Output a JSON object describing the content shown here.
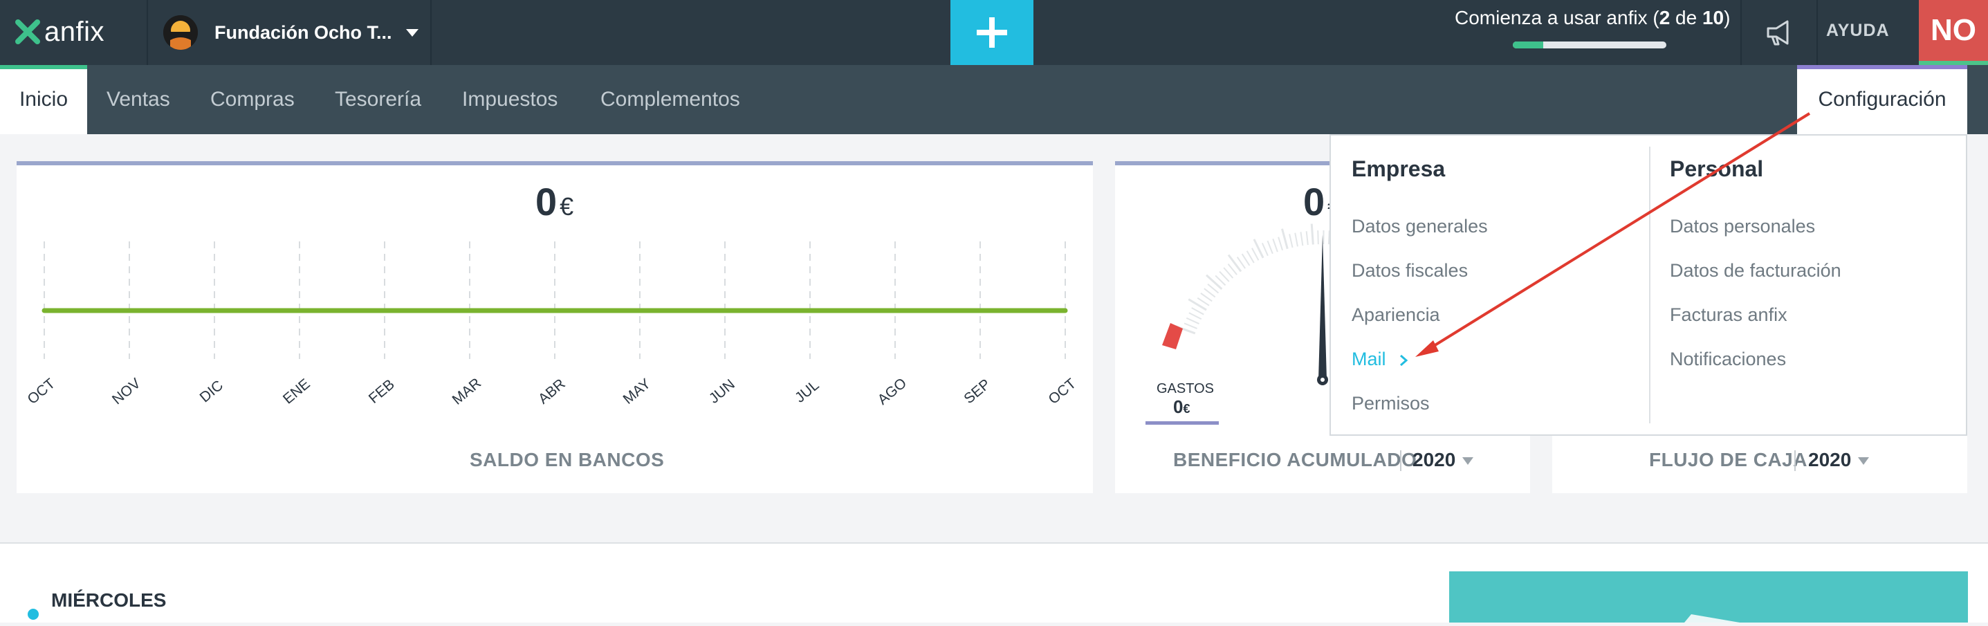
{
  "topbar": {
    "logo_text": "anfix",
    "company_name": "Fundación Ocho T...",
    "add_button_symbol": "+",
    "onboarding": {
      "prefix": "Comienza a usar anfix (",
      "done": "2",
      "mid": " de ",
      "total": "10",
      "suffix": ")",
      "progress_fraction": 0.2
    },
    "help_label": "AYUDA",
    "user_initials": "NO",
    "colors": {
      "bar": "#2c3a44",
      "accent": "#22bde0",
      "user": "#d9534f"
    }
  },
  "nav": {
    "tabs": [
      {
        "label": "Inicio",
        "active": true
      },
      {
        "label": "Ventas"
      },
      {
        "label": "Compras"
      },
      {
        "label": "Tesorería"
      },
      {
        "label": "Impuestos"
      },
      {
        "label": "Complementos"
      }
    ],
    "config_label": "Configuración"
  },
  "cards": {
    "saldo": {
      "amount": "0",
      "currency": "€",
      "title": "SALDO EN BANCOS"
    },
    "beneficio": {
      "amount": "0",
      "currency": "€",
      "title": "BENEFICIO ACUMULADO",
      "year": "2020",
      "gastos_label": "GASTOS",
      "gastos_amount": "0",
      "gastos_currency": "€"
    },
    "flujo": {
      "title": "FLUJO DE CAJA",
      "year": "2020"
    }
  },
  "chart_data": {
    "type": "line",
    "categories": [
      "OCT",
      "NOV",
      "DIC",
      "ENE",
      "FEB",
      "MAR",
      "ABR",
      "MAY",
      "JUN",
      "JUL",
      "AGO",
      "SEP",
      "OCT"
    ],
    "series": [
      {
        "values": [
          0,
          0,
          0,
          0,
          0,
          0,
          0,
          0,
          0,
          0,
          0,
          0,
          0
        ],
        "color": "#7ab32e"
      }
    ],
    "title": "SALDO EN BANCOS",
    "grid": "vertical dashed"
  },
  "dropdown": {
    "empresa": {
      "title": "Empresa",
      "items": [
        "Datos generales",
        "Datos fiscales",
        "Apariencia",
        "Mail",
        "Permisos"
      ],
      "active": "Mail"
    },
    "personal": {
      "title": "Personal",
      "items": [
        "Datos personales",
        "Datos de facturación",
        "Facturas anfix",
        "Notificaciones"
      ]
    }
  },
  "agenda": {
    "day": "MIÉRCOLES"
  }
}
